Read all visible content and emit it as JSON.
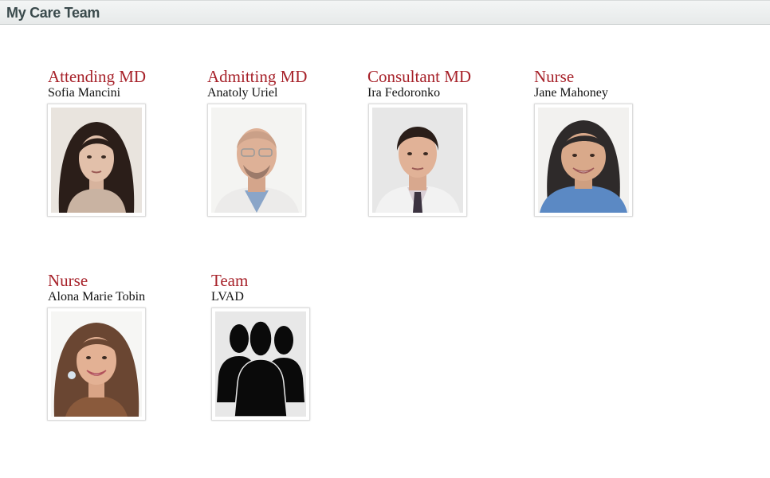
{
  "header": {
    "title": "My Care Team"
  },
  "care_team": [
    {
      "role": "Attending MD",
      "name": "Sofia Mancini",
      "photo": "person-photo"
    },
    {
      "role": "Admitting MD",
      "name": "Anatoly Uriel",
      "photo": "person-photo"
    },
    {
      "role": "Consultant MD",
      "name": "Ira Fedoronko",
      "photo": "person-photo"
    },
    {
      "role": "Nurse",
      "name": "Jane Mahoney",
      "photo": "person-photo"
    },
    {
      "role": "Nurse",
      "name": "Alona Marie Tobin",
      "photo": "person-photo"
    },
    {
      "role": "Team",
      "name": "LVAD",
      "photo": "group-silhouette-icon"
    }
  ]
}
